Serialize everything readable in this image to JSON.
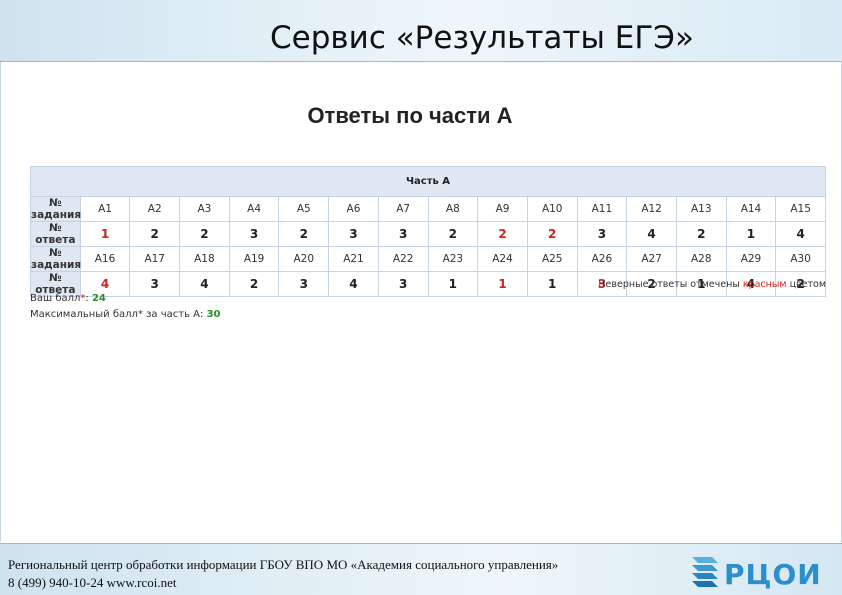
{
  "slide": {
    "title": "Сервис «Результаты ЕГЭ»",
    "subtitle": "Ответы по части А"
  },
  "table": {
    "section_title": "Часть А",
    "rows": [
      {
        "type": "task",
        "label": "№ задания",
        "cells": [
          "A1",
          "A2",
          "A3",
          "A4",
          "A5",
          "A6",
          "A7",
          "A8",
          "A9",
          "A10",
          "A11",
          "A12",
          "A13",
          "A14",
          "A15"
        ]
      },
      {
        "type": "answer",
        "label": "№ ответа",
        "cells": [
          "1",
          "2",
          "2",
          "3",
          "2",
          "3",
          "3",
          "2",
          "2",
          "2",
          "3",
          "4",
          "2",
          "1",
          "4"
        ],
        "wrong": [
          true,
          false,
          false,
          false,
          false,
          false,
          false,
          false,
          true,
          true,
          false,
          false,
          false,
          false,
          false
        ]
      },
      {
        "type": "task",
        "label": "№ задания",
        "cells": [
          "A16",
          "A17",
          "A18",
          "A19",
          "A20",
          "A21",
          "A22",
          "A23",
          "A24",
          "A25",
          "A26",
          "A27",
          "A28",
          "A29",
          "A30"
        ]
      },
      {
        "type": "answer",
        "label": "№ ответа",
        "cells": [
          "4",
          "3",
          "4",
          "2",
          "3",
          "4",
          "3",
          "1",
          "1",
          "1",
          "3",
          "2",
          "1",
          "4",
          "2"
        ],
        "wrong": [
          true,
          false,
          false,
          false,
          false,
          false,
          false,
          false,
          true,
          false,
          true,
          false,
          false,
          false,
          false
        ]
      }
    ]
  },
  "note": {
    "before": "Неверные ответы отмечены ",
    "highlight": "красным",
    "after": " цветом"
  },
  "score": {
    "your_label": "Ваш балл",
    "star": "*",
    "your_value": "24",
    "max_label": "Максимальный балл* за часть А:",
    "max_value": "30"
  },
  "footer": {
    "line1": "Региональный центр обработки информации ГБОУ ВПО МО «Академия социального управления»",
    "line2": "8 (499) 940-10-24 www.rcoi.net"
  },
  "logo": {
    "text": "РЦОИ",
    "icon": "rcoi-logo-icon"
  },
  "colors": {
    "wrong": "#d62020",
    "score": "#2e8b2e",
    "header_cell": "#dfe7f3",
    "logo": "#2a8fcc"
  }
}
